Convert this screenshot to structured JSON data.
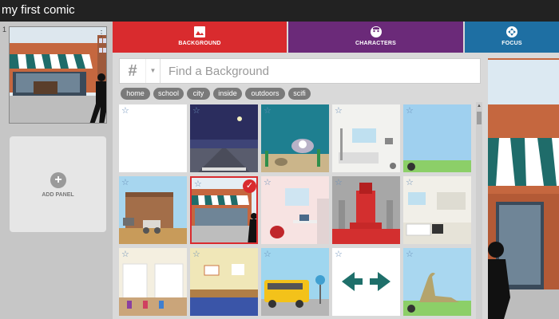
{
  "app": {
    "title": "my first comic"
  },
  "panels": {
    "items": [
      {
        "number": "1"
      }
    ],
    "add_label": "ADD PANEL"
  },
  "tabs": [
    {
      "label": "BACKGROUND",
      "color": "#d92b2e",
      "icon": "image-icon"
    },
    {
      "label": "CHARACTERS",
      "color": "#6b2a79",
      "icon": "face-icon"
    },
    {
      "label": "FOCUS",
      "color": "#1e6fa3",
      "icon": "move-icon"
    }
  ],
  "search": {
    "placeholder": "Find a Background",
    "hash": "#"
  },
  "tags": [
    "home",
    "school",
    "city",
    "inside",
    "outdoors",
    "scifi"
  ],
  "backgrounds": [
    "blank",
    "night-street",
    "underwater",
    "hospital-room",
    "sky-field",
    "western-town",
    "storefront-selected",
    "bedroom",
    "throne-room",
    "kitchen",
    "classroom",
    "gym",
    "school-bus",
    "arrows",
    "dinosaur-field"
  ],
  "selected_background": "storefront-selected",
  "colors": {
    "accent": "#d92b2e",
    "purple": "#6b2a79",
    "blue": "#1e6fa3"
  }
}
